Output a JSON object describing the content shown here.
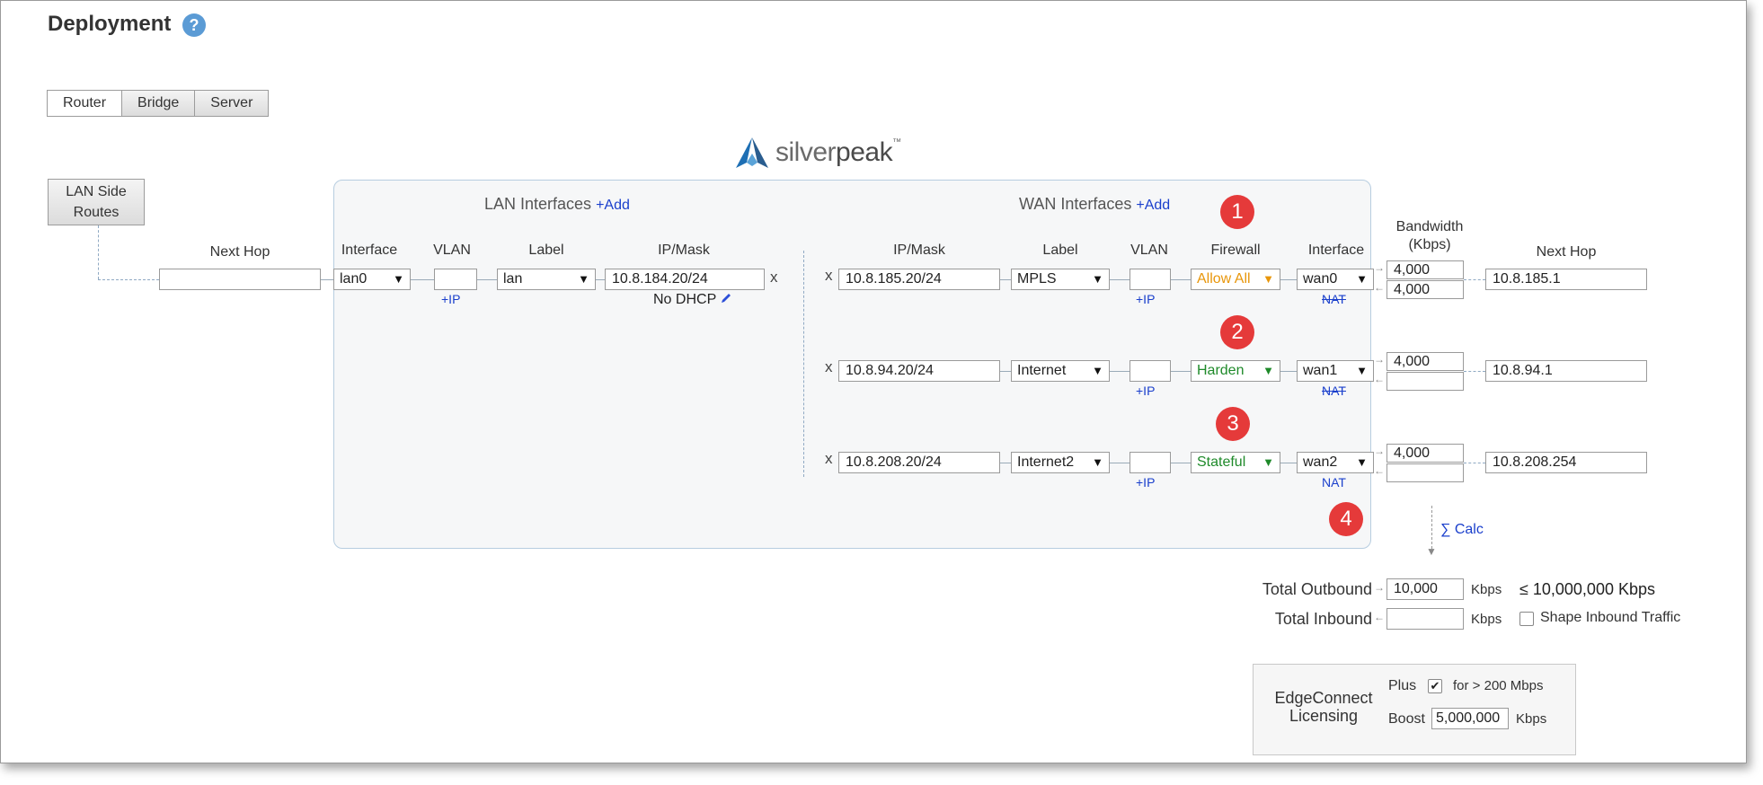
{
  "page": {
    "title": "Deployment",
    "help_icon_glyph": "?"
  },
  "modes": [
    {
      "label": "Router",
      "active": true
    },
    {
      "label": "Bridge",
      "active": false
    },
    {
      "label": "Server",
      "active": false
    }
  ],
  "logo": {
    "text_light": "silver",
    "text_dark": "peak",
    "tm": "™"
  },
  "lan_routes_button": {
    "line1": "LAN Side",
    "line2": "Routes"
  },
  "lan_next_hop": {
    "header": "Next Hop",
    "value": ""
  },
  "lan": {
    "section_title": "LAN Interfaces",
    "add_label": "+Add",
    "headers": {
      "interface": "Interface",
      "vlan": "VLAN",
      "label": "Label",
      "ipmask": "IP/Mask"
    },
    "row": {
      "interface": "lan0",
      "vlan": "",
      "add_ip": "+IP",
      "label": "lan",
      "ipmask": "10.8.184.20/24",
      "remove": "x",
      "dhcp": "No DHCP"
    }
  },
  "wan": {
    "section_title": "WAN Interfaces",
    "add_label": "+Add",
    "headers": {
      "ipmask": "IP/Mask",
      "label": "Label",
      "vlan": "VLAN",
      "firewall": "Firewall",
      "interface": "Interface",
      "bandwidth": "Bandwidth",
      "bandwidth_unit": "(Kbps)",
      "next_hop": "Next Hop"
    },
    "rows": [
      {
        "remove": "x",
        "ipmask": "10.8.185.20/24",
        "label": "MPLS",
        "vlan": "",
        "add_ip": "+IP",
        "firewall": "Allow All",
        "firewall_color": "#e8960a",
        "interface": "wan0",
        "nat": "NAT",
        "nat_struck": true,
        "bw_out": "4,000",
        "bw_in": "4,000",
        "next_hop": "10.8.185.1",
        "badge": "1"
      },
      {
        "remove": "x",
        "ipmask": "10.8.94.20/24",
        "label": "Internet",
        "vlan": "",
        "add_ip": "+IP",
        "firewall": "Harden",
        "firewall_color": "#1f8a2a",
        "interface": "wan1",
        "nat": "NAT",
        "nat_struck": true,
        "bw_out": "4,000",
        "bw_in": "",
        "next_hop": "10.8.94.1",
        "badge": "2"
      },
      {
        "remove": "x",
        "ipmask": "10.8.208.20/24",
        "label": "Internet2",
        "vlan": "",
        "add_ip": "+IP",
        "firewall": "Stateful",
        "firewall_color": "#1f8a2a",
        "interface": "wan2",
        "nat": "NAT",
        "nat_struck": false,
        "bw_out": "4,000",
        "bw_in": "",
        "next_hop": "10.8.208.254",
        "badge": "3"
      }
    ],
    "badge4": "4",
    "calc_label": "∑ Calc"
  },
  "totals": {
    "outbound_label": "Total Outbound",
    "outbound_value": "10,000",
    "outbound_unit": "Kbps",
    "outbound_limit": "≤ 10,000,000 Kbps",
    "inbound_label": "Total Inbound",
    "inbound_value": "",
    "inbound_unit": "Kbps",
    "shape_inbound_label": "Shape Inbound Traffic",
    "shape_inbound_checked": false
  },
  "licensing": {
    "title_line1": "EdgeConnect",
    "title_line2": "Licensing",
    "plus_label": "Plus",
    "plus_checked": true,
    "plus_note": "for > 200 Mbps",
    "boost_label": "Boost",
    "boost_value": "5,000,000",
    "boost_unit": "Kbps"
  }
}
